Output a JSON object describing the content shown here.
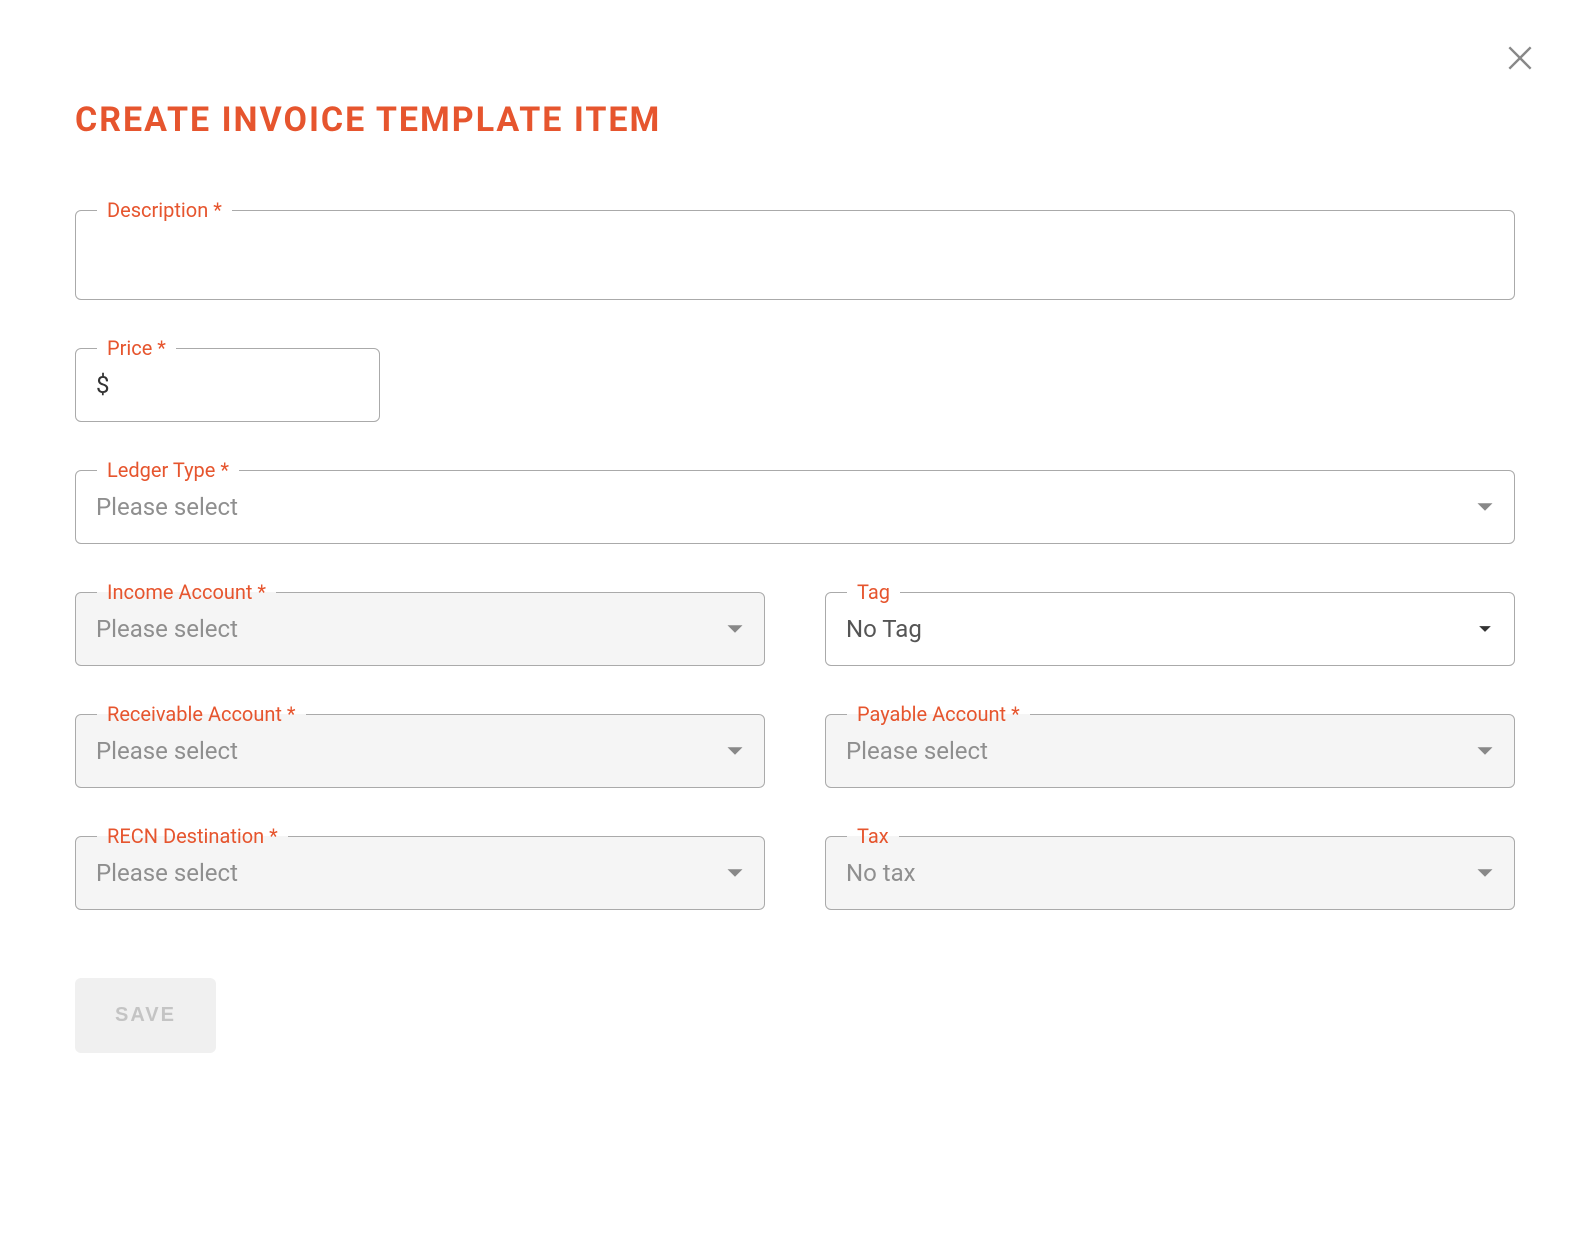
{
  "modal": {
    "title": "CREATE INVOICE TEMPLATE ITEM",
    "close_icon": "close-icon"
  },
  "fields": {
    "description": {
      "label": "Description *",
      "value": ""
    },
    "price": {
      "label": "Price *",
      "prefix": "$",
      "value": ""
    },
    "ledger_type": {
      "label": "Ledger Type *",
      "placeholder": "Please select"
    },
    "income_account": {
      "label": "Income Account *",
      "placeholder": "Please select",
      "disabled": true
    },
    "tag": {
      "label": "Tag",
      "value": "No Tag"
    },
    "receivable_account": {
      "label": "Receivable Account *",
      "placeholder": "Please select",
      "disabled": true
    },
    "payable_account": {
      "label": "Payable Account *",
      "placeholder": "Please select",
      "disabled": true
    },
    "recn_destination": {
      "label": "RECN Destination *",
      "placeholder": "Please select",
      "disabled": true
    },
    "tax": {
      "label": "Tax",
      "placeholder": "No tax",
      "disabled": true
    }
  },
  "actions": {
    "save_label": "SAVE"
  }
}
